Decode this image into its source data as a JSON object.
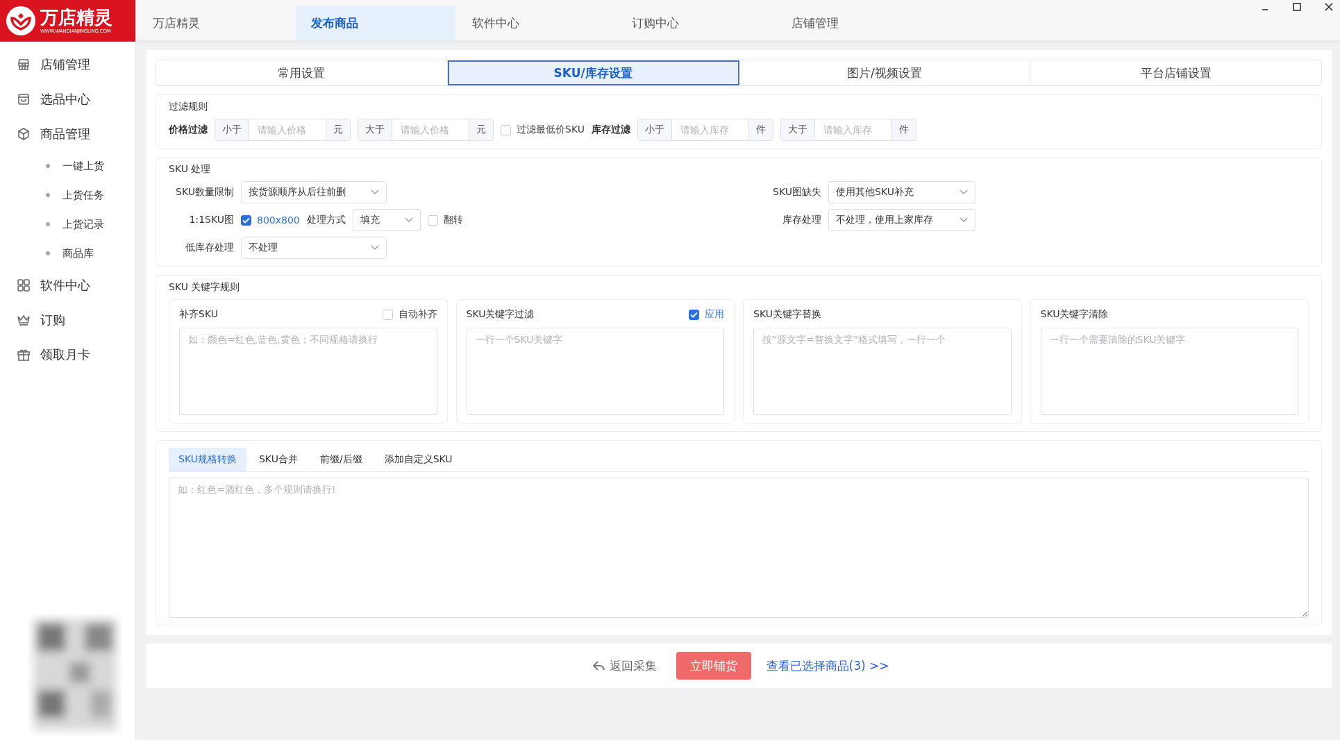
{
  "logo": {
    "name": "万店精灵",
    "url": "WWW.WANDIANJINGLING.COM"
  },
  "top_nav": [
    {
      "label": "万店精灵",
      "selected": false
    },
    {
      "label": "发布商品",
      "selected": true
    },
    {
      "label": "软件中心",
      "selected": false
    },
    {
      "label": "订购中心",
      "selected": false
    },
    {
      "label": "店铺管理",
      "selected": false
    }
  ],
  "sidebar": {
    "items": [
      {
        "label": "店铺管理"
      },
      {
        "label": "选品中心"
      },
      {
        "label": "商品管理",
        "children": [
          {
            "label": "一键上货"
          },
          {
            "label": "上货任务"
          },
          {
            "label": "上货记录"
          },
          {
            "label": "商品库"
          }
        ]
      },
      {
        "label": "软件中心"
      },
      {
        "label": "订购"
      },
      {
        "label": "领取月卡"
      }
    ]
  },
  "settings_tabs": [
    {
      "label": "常用设置",
      "selected": false
    },
    {
      "label": "SKU/库存设置",
      "selected": true
    },
    {
      "label": "图片/视频设置",
      "selected": false
    },
    {
      "label": "平台店铺设置",
      "selected": false
    }
  ],
  "filter": {
    "title": "过滤规则",
    "price": {
      "label": "价格过滤",
      "min": {
        "prefix": "小于",
        "placeholder": "请输入价格",
        "suffix": "元"
      },
      "max": {
        "prefix": "大于",
        "placeholder": "请输入价格",
        "suffix": "元"
      }
    },
    "lowest_sku": {
      "label": "过滤最低价SKU",
      "checked": false
    },
    "stock": {
      "label": "库存过滤",
      "min": {
        "prefix": "小于",
        "placeholder": "请输入库存",
        "suffix": "件"
      },
      "max": {
        "prefix": "大于",
        "placeholder": "请输入库存",
        "suffix": "件"
      }
    }
  },
  "sku_processing": {
    "title": "SKU 处理",
    "quantity_limit": {
      "label": "SKU数量限制",
      "value": "按货源顺序从后往前删"
    },
    "square_image": {
      "label": "1:1SKU图",
      "checked": true,
      "size": "800x800",
      "method_label": "处理方式",
      "method_value": "填充",
      "flip": {
        "label": "翻转",
        "checked": false
      }
    },
    "low_stock": {
      "label": "低库存处理",
      "value": "不处理"
    },
    "missing_image": {
      "label": "SKU图缺失",
      "value": "使用其他SKU补充"
    },
    "stock_handling": {
      "label": "库存处理",
      "value": "不处理，使用上家库存"
    }
  },
  "keyword_rules": {
    "title": "SKU 关键字规则",
    "cards": [
      {
        "title": "补齐SKU",
        "option": {
          "label": "自动补齐",
          "checked": false
        },
        "placeholder": "如：颜色=红色,蓝色,黄色；不同规格请换行"
      },
      {
        "title": "SKU关键字过滤",
        "option": {
          "label": "应用",
          "checked": true
        },
        "placeholder": "一行一个SKU关键字"
      },
      {
        "title": "SKU关键字替换",
        "placeholder": "按“源文字=替换文字”格式填写，一行一个"
      },
      {
        "title": "SKU关键字清除",
        "placeholder": "一行一个需要清除的SKU关键字"
      }
    ]
  },
  "conversion": {
    "tabs": [
      {
        "label": "SKU规格转换",
        "selected": true
      },
      {
        "label": "SKU合并",
        "selected": false
      },
      {
        "label": "前缀/后缀",
        "selected": false
      },
      {
        "label": "添加自定义SKU",
        "selected": false
      }
    ],
    "placeholder": "如：红色=酒红色，多个规则请换行!"
  },
  "footer": {
    "back": "返回采集",
    "primary": "立即铺货",
    "link": "查看已选择商品(3) >>"
  }
}
